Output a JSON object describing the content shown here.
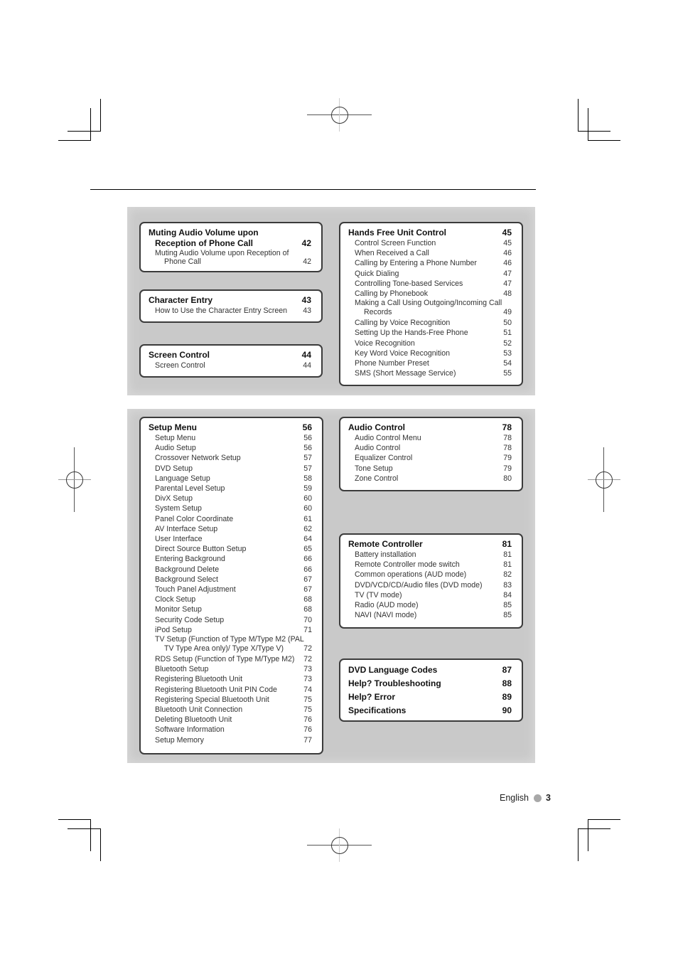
{
  "page": {
    "language_label": "English",
    "page_number": "3"
  },
  "toc": {
    "muting": {
      "title_line1": "Muting Audio Volume upon",
      "title_line2": "Reception of Phone Call",
      "page": "42",
      "items": [
        {
          "line1": "Muting Audio Volume upon Reception of",
          "line2": "Phone Call",
          "page": "42"
        }
      ]
    },
    "character_entry": {
      "title": "Character Entry",
      "page": "43",
      "items": [
        {
          "label": "How to Use the Character Entry Screen",
          "page": "43"
        }
      ]
    },
    "screen_control": {
      "title": "Screen Control",
      "page": "44",
      "items": [
        {
          "label": "Screen Control",
          "page": "44"
        }
      ]
    },
    "hands_free": {
      "title": "Hands Free Unit Control",
      "page": "45",
      "items": [
        {
          "label": "Control Screen Function",
          "page": "45"
        },
        {
          "label": "When Received a Call",
          "page": "46"
        },
        {
          "label": "Calling by Entering a Phone Number",
          "page": "46"
        },
        {
          "label": "Quick Dialing",
          "page": "47"
        },
        {
          "label": "Controlling Tone-based Services",
          "page": "47"
        },
        {
          "label": "Calling by Phonebook",
          "page": "48"
        },
        {
          "line1": "Making a Call Using Outgoing/Incoming Call",
          "line2": "Records",
          "page": "49"
        },
        {
          "label": "Calling by Voice Recognition",
          "page": "50"
        },
        {
          "label": "Setting Up the Hands-Free Phone",
          "page": "51"
        },
        {
          "label": "Voice Recognition",
          "page": "52"
        },
        {
          "label": "Key Word Voice Recognition",
          "page": "53"
        },
        {
          "label": "Phone Number Preset",
          "page": "54"
        },
        {
          "label": "SMS (Short Message Service)",
          "page": "55"
        }
      ]
    },
    "setup_menu": {
      "title": "Setup Menu",
      "page": "56",
      "items": [
        {
          "label": "Setup Menu",
          "page": "56"
        },
        {
          "label": "Audio Setup",
          "page": "56"
        },
        {
          "label": "Crossover Network Setup",
          "page": "57"
        },
        {
          "label": "DVD Setup",
          "page": "57"
        },
        {
          "label": "Language Setup",
          "page": "58"
        },
        {
          "label": "Parental Level Setup",
          "page": "59"
        },
        {
          "label": "DivX Setup",
          "page": "60"
        },
        {
          "label": "System Setup",
          "page": "60"
        },
        {
          "label": "Panel Color Coordinate",
          "page": "61"
        },
        {
          "label": "AV Interface Setup",
          "page": "62"
        },
        {
          "label": "User Interface",
          "page": "64"
        },
        {
          "label": "Direct Source Button Setup",
          "page": "65"
        },
        {
          "label": "Entering Background",
          "page": "66"
        },
        {
          "label": "Background Delete",
          "page": "66"
        },
        {
          "label": "Background Select",
          "page": "67"
        },
        {
          "label": "Touch Panel Adjustment",
          "page": "67"
        },
        {
          "label": "Clock Setup",
          "page": "68"
        },
        {
          "label": "Monitor Setup",
          "page": "68"
        },
        {
          "label": "Security Code Setup",
          "page": "70"
        },
        {
          "label": "iPod Setup",
          "page": "71"
        },
        {
          "line1": "TV Setup (Function of Type M/Type M2 (PAL",
          "line2": "TV Type Area only)/ Type X/Type V)",
          "page": "72"
        },
        {
          "label": "RDS Setup (Function of Type M/Type M2)",
          "page": "72"
        },
        {
          "label": "Bluetooth Setup",
          "page": "73"
        },
        {
          "label": "Registering Bluetooth Unit",
          "page": "73"
        },
        {
          "label": "Registering Bluetooth Unit PIN Code",
          "page": "74"
        },
        {
          "label": "Registering Special Bluetooth Unit",
          "page": "75"
        },
        {
          "label": "Bluetooth Unit Connection",
          "page": "75"
        },
        {
          "label": "Deleting Bluetooth Unit",
          "page": "76"
        },
        {
          "label": "Software Information",
          "page": "76"
        },
        {
          "label": "Setup Memory",
          "page": "77"
        }
      ]
    },
    "audio_control": {
      "title": "Audio Control",
      "page": "78",
      "items": [
        {
          "label": "Audio Control Menu",
          "page": "78"
        },
        {
          "label": "Audio Control",
          "page": "78"
        },
        {
          "label": "Equalizer Control",
          "page": "79"
        },
        {
          "label": "Tone Setup",
          "page": "79"
        },
        {
          "label": "Zone Control",
          "page": "80"
        }
      ]
    },
    "remote_controller": {
      "title": "Remote Controller",
      "page": "81",
      "items": [
        {
          "label": "Battery installation",
          "page": "81"
        },
        {
          "label": "Remote Controller mode switch",
          "page": "81"
        },
        {
          "label": "Common operations (AUD mode)",
          "page": "82"
        },
        {
          "label": "DVD/VCD/CD/Audio files (DVD mode)",
          "page": "83"
        },
        {
          "label": "TV (TV mode)",
          "page": "84"
        },
        {
          "label": "Radio (AUD mode)",
          "page": "85"
        },
        {
          "label": "NAVI (NAVI mode)",
          "page": "85"
        }
      ]
    },
    "appendix": [
      {
        "title": "DVD Language Codes",
        "page": "87"
      },
      {
        "title": "Help? Troubleshooting",
        "page": "88"
      },
      {
        "title": "Help? Error",
        "page": "89"
      },
      {
        "title": "Specifications",
        "page": "90"
      }
    ]
  }
}
